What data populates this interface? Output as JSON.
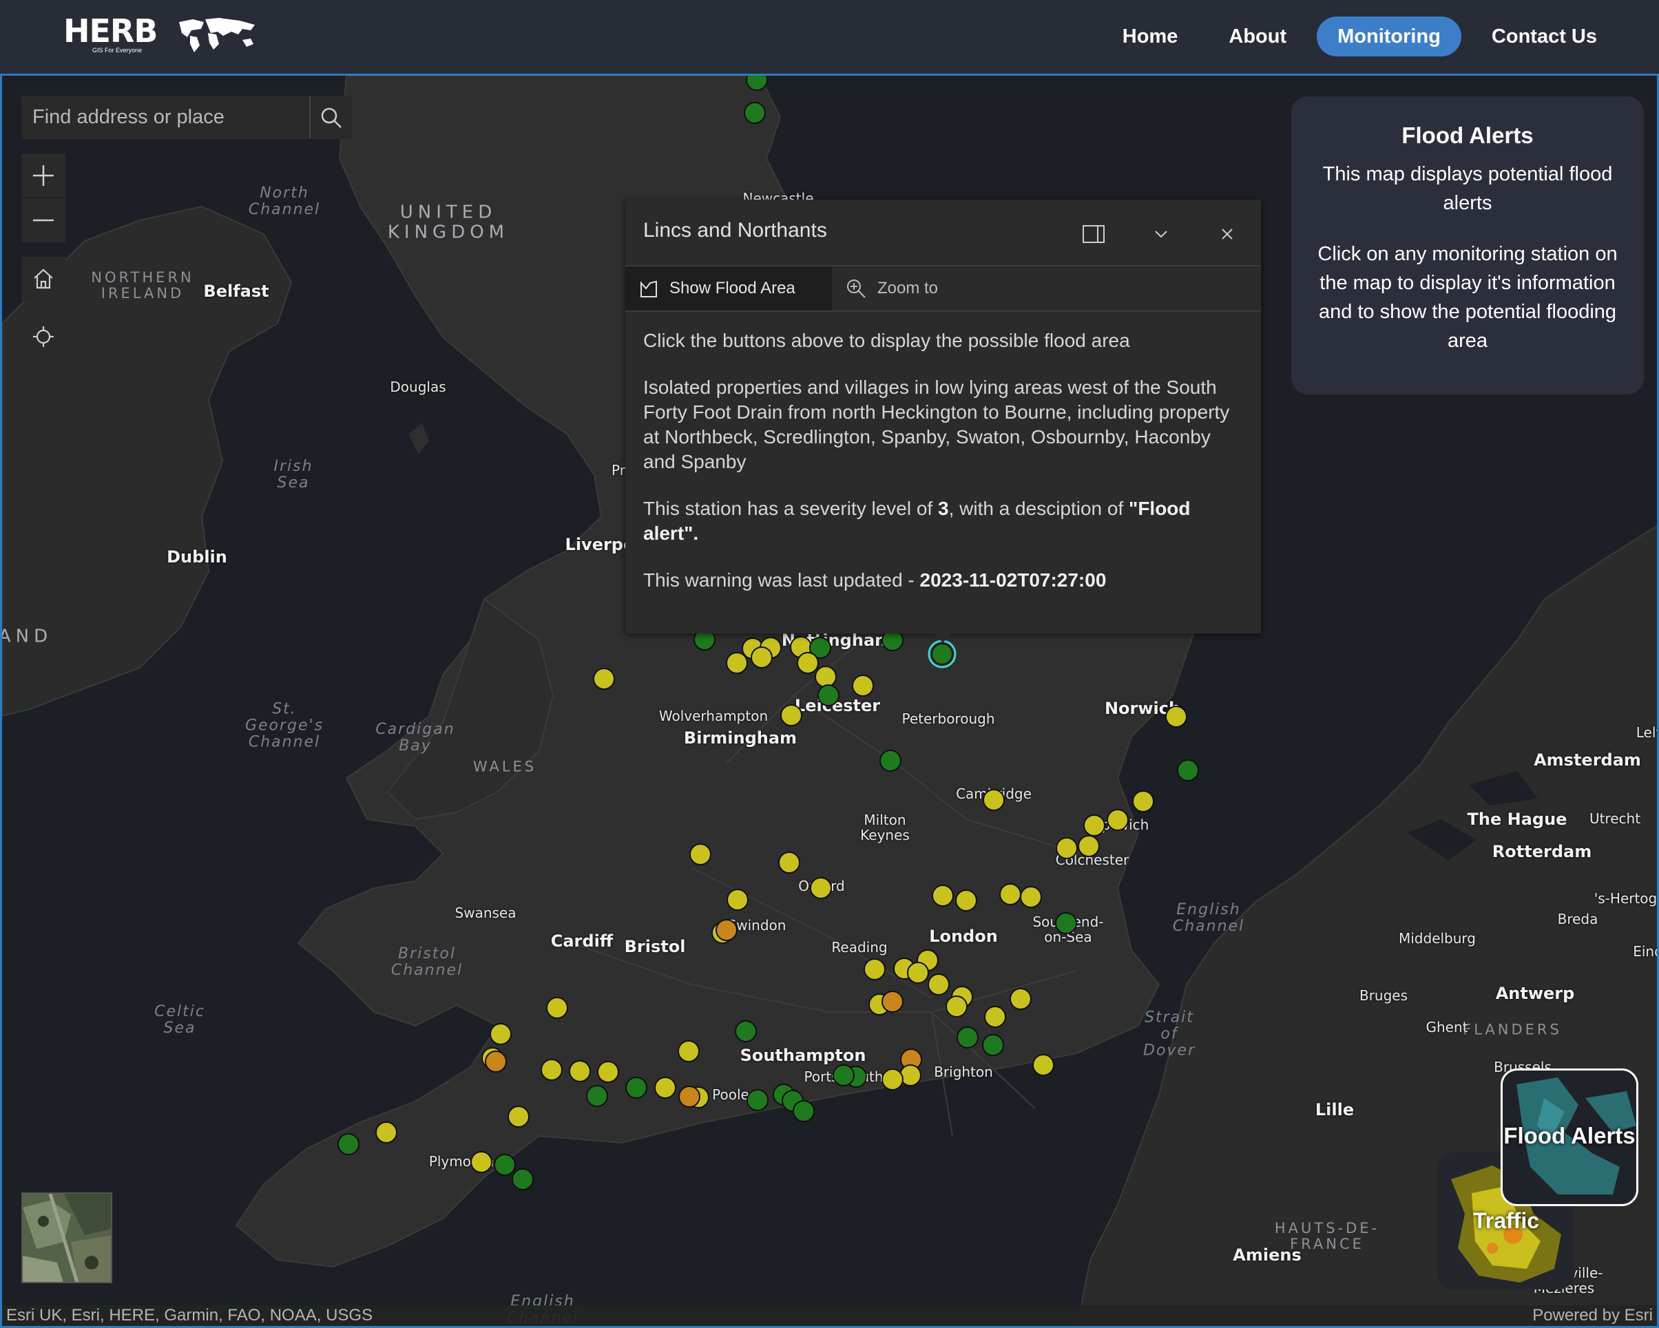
{
  "header": {
    "logo_text": "HERB",
    "logo_tagline": "GIS For Everyone",
    "nav": [
      {
        "label": "Home",
        "active": false
      },
      {
        "label": "About",
        "active": false
      },
      {
        "label": "Monitoring",
        "active": true
      },
      {
        "label": "Contact Us",
        "active": false
      }
    ],
    "accent_color": "#3d7ec9"
  },
  "search": {
    "placeholder": "Find address or place"
  },
  "map_labels": {
    "water": [
      "North Channel",
      "Irish Sea",
      "St. George's Channel",
      "Cardigan Bay",
      "Bristol Channel",
      "Celtic Sea",
      "English Channel",
      "English Channel",
      "Strait of Dover"
    ],
    "regions": [
      "NORTHERN IRELAND",
      "WALES",
      "FLANDERS",
      "HAUTS-DE-FRANCE"
    ],
    "countries": [
      "UNITED KINGDOM",
      "AND"
    ],
    "major_cities": [
      "Belfast",
      "Dublin",
      "Liverpo",
      "Nottingham",
      "Leicester",
      "Birmingham",
      "Norwich",
      "Cardiff",
      "Bristol",
      "London",
      "Southampton",
      "Amsterdam",
      "The Hague",
      "Rotterdam",
      "Antwerp",
      "Lille"
    ],
    "cities": [
      "Newcastle",
      "Douglas",
      "Pr",
      "Wolverhampton",
      "Peterborough",
      "Cambridge",
      "Milton Keynes",
      "Ipswich",
      "Colchester",
      "Oxford",
      "Swansea",
      "Swindon",
      "Reading",
      "Southend-on-Sea",
      "Portsmouth",
      "Brighton",
      "Poole",
      "Plymouth",
      "Middelburg",
      "Bruges",
      "Ghent",
      "Breda",
      "Utrecht",
      "'s-Hertogen",
      "Eind",
      "Brussels",
      "Amiens",
      "Lely",
      "Charleville-Mézières"
    ]
  },
  "popup": {
    "title": "Lincs and Northants",
    "actions": [
      "Show Flood Area",
      "Zoom to"
    ],
    "intro": "Click the buttons above to display the possible flood area",
    "description": "Isolated properties and villages in low lying areas west of the South Forty Foot Drain from north Heckington to Bourne, including property at Northbeck, Scredlington, Spanby, Swaton, Osbournby, Haconby and Spanby",
    "severity_prefix": "This station has a severity level of ",
    "severity_level": "3",
    "severity_mid": ", with a desciption of ",
    "severity_desc": "\"Flood alert\".",
    "updated_prefix": "This warning was last updated - ",
    "updated_value": "2023-11-02T07:27:00"
  },
  "info_card": {
    "title": "Flood Alerts",
    "line1": "This map displays potential flood alerts",
    "line2": "Click on any monitoring station on the map to display it's information and to show the potential flooding area"
  },
  "layers": {
    "flood_label": "Flood Alerts",
    "traffic_label": "Traffic"
  },
  "attribution": {
    "left": "Esri UK, Esri, HERE, Garmin, FAO, NOAA, USGS",
    "right": "Powered by Esri"
  },
  "station_colors": {
    "severe": "#c8861c",
    "alert": "#c9c21e",
    "normal": "#1f7a1f"
  }
}
